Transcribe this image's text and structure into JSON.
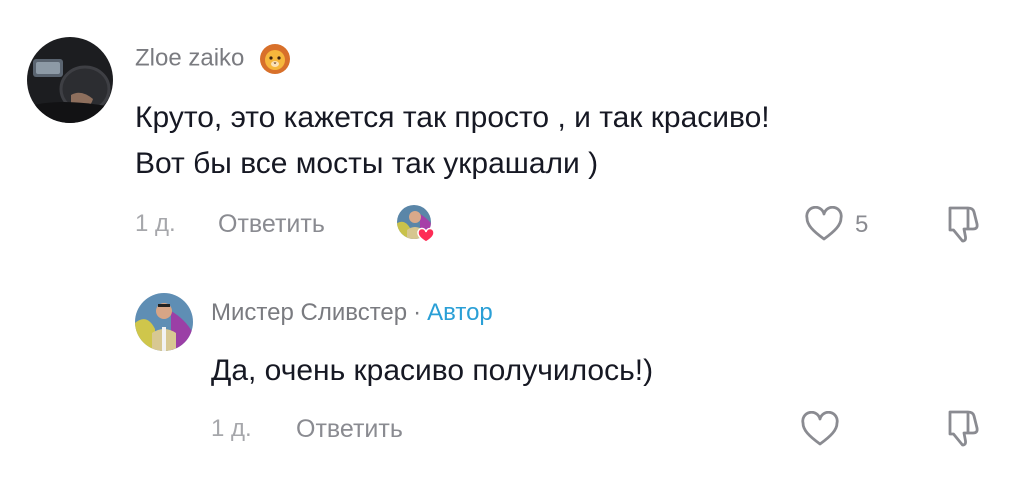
{
  "comments": [
    {
      "username": "Zloe zaiko",
      "username_emoji": "lion-face-emoji",
      "text_line1": "Круто, это кажется так просто , и так красиво!",
      "text_line2": "Вот бы все мосты так украшали )",
      "time": "1 д.",
      "reply_label": "Ответить",
      "like_count": "5",
      "liked_by_creator": true
    }
  ],
  "reply": {
    "username": "Мистер Сливстер",
    "separator": "·",
    "author_badge": "Автор",
    "text": "Да, очень красиво получилось!)",
    "time": "1 д.",
    "reply_label": "Ответить"
  },
  "colors": {
    "text": "#161823",
    "secondary": "#8a8b91",
    "author_badge": "#2a9fd6",
    "heart_red": "#fe2c55"
  },
  "icons": [
    "heart-outline-icon",
    "thumbs-down-icon",
    "lion-face-emoji"
  ]
}
